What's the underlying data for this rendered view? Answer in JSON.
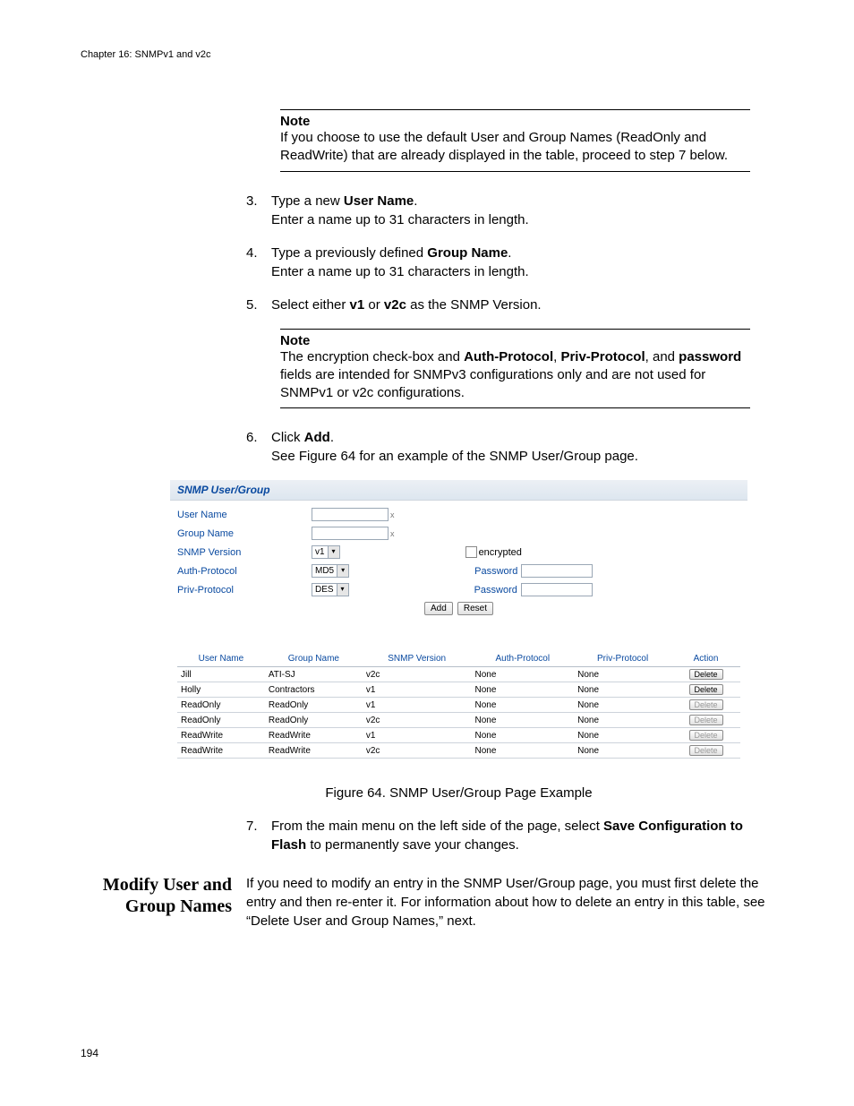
{
  "chapter_header": "Chapter 16: SNMPv1 and v2c",
  "note1": {
    "title": "Note",
    "body": "If you choose to use the default User and Group Names (ReadOnly and ReadWrite) that are already displayed in the table, proceed to step 7 below."
  },
  "step3": {
    "num": "3.",
    "line1_pre": "Type a new ",
    "line1_bold": "User Name",
    "line1_post": ".",
    "line2": "Enter a name up to 31 characters in length."
  },
  "step4": {
    "num": "4.",
    "line1_pre": "Type a previously defined ",
    "line1_bold": "Group Name",
    "line1_post": ".",
    "line2": "Enter a name up to 31 characters in length."
  },
  "step5": {
    "num": "5.",
    "pre": "Select either ",
    "b1": "v1",
    "mid": " or ",
    "b2": "v2c",
    "post": " as the SNMP Version."
  },
  "note2": {
    "title": "Note",
    "pre": "The encryption check-box and ",
    "b1": "Auth-Protocol",
    "sep1": ", ",
    "b2": "Priv-Protocol",
    "sep2": ", and ",
    "b3": "password",
    "post": " fields are intended for SNMPv3 configurations only and are not used for SNMPv1 or v2c configurations."
  },
  "step6": {
    "num": "6.",
    "line1_pre": "Click ",
    "line1_bold": "Add",
    "line1_post": ".",
    "line2": "See Figure 64 for an example of the SNMP User/Group page."
  },
  "ui": {
    "panel_title": "SNMP User/Group",
    "labels": {
      "user_name": "User Name",
      "group_name": "Group Name",
      "snmp_version": "SNMP Version",
      "auth_protocol": "Auth-Protocol",
      "priv_protocol": "Priv-Protocol",
      "encrypted": "encrypted",
      "password": "Password"
    },
    "selects": {
      "snmp_version": "v1",
      "auth_protocol": "MD5",
      "priv_protocol": "DES"
    },
    "field_hint": "x",
    "buttons": {
      "add": "Add",
      "reset": "Reset"
    },
    "table": {
      "headers": [
        "User Name",
        "Group Name",
        "SNMP Version",
        "Auth-Protocol",
        "Priv-Protocol",
        "Action"
      ],
      "action_label": "Delete",
      "rows": [
        {
          "user": "Jill",
          "group": "ATI-SJ",
          "ver": "v2c",
          "auth": "None",
          "priv": "None",
          "enabled": true
        },
        {
          "user": "Holly",
          "group": "Contractors",
          "ver": "v1",
          "auth": "None",
          "priv": "None",
          "enabled": true
        },
        {
          "user": "ReadOnly",
          "group": "ReadOnly",
          "ver": "v1",
          "auth": "None",
          "priv": "None",
          "enabled": false
        },
        {
          "user": "ReadOnly",
          "group": "ReadOnly",
          "ver": "v2c",
          "auth": "None",
          "priv": "None",
          "enabled": false
        },
        {
          "user": "ReadWrite",
          "group": "ReadWrite",
          "ver": "v1",
          "auth": "None",
          "priv": "None",
          "enabled": false
        },
        {
          "user": "ReadWrite",
          "group": "ReadWrite",
          "ver": "v2c",
          "auth": "None",
          "priv": "None",
          "enabled": false
        }
      ]
    }
  },
  "figure_caption": "Figure 64. SNMP User/Group Page Example",
  "step7": {
    "num": "7.",
    "pre": "From the main menu on the left side of the page, select ",
    "b1": "Save Configuration to Flash",
    "post": " to permanently save your changes."
  },
  "section": {
    "heading": "Modify User and Group Names",
    "para": "If you need to modify an entry in the SNMP User/Group page, you must first delete the entry and then re-enter it. For information about how to delete an entry in this table, see “Delete User and Group Names,”  next."
  },
  "page_number": "194"
}
